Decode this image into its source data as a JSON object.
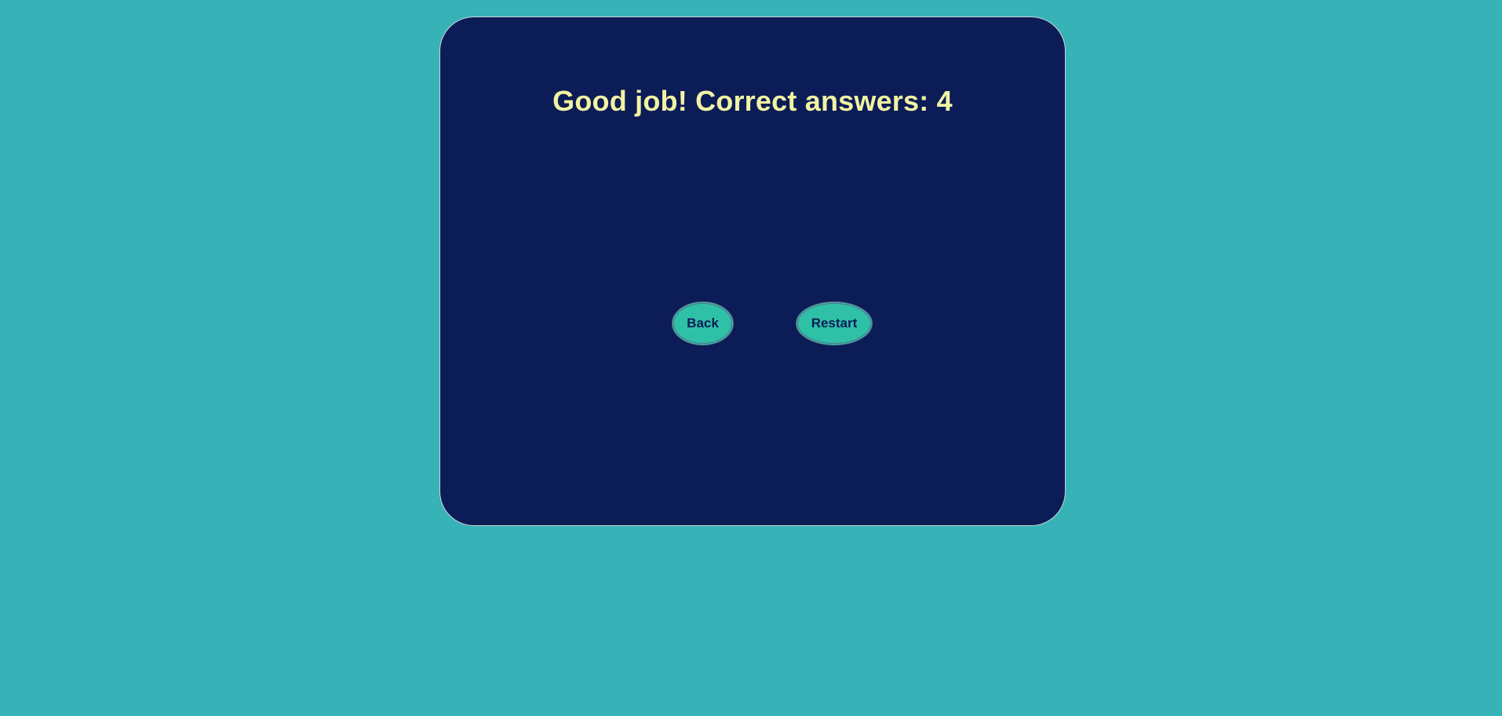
{
  "colors": {
    "page_background": "#37b2b6",
    "card_background": "#0c1c57",
    "title_text": "#f2f3a3",
    "button_background": "#2fc1a7",
    "button_text": "#0c1c57"
  },
  "result": {
    "message": "Good job! Correct answers: 4"
  },
  "actions": {
    "back_label": "Back",
    "restart_label": "Restart"
  }
}
